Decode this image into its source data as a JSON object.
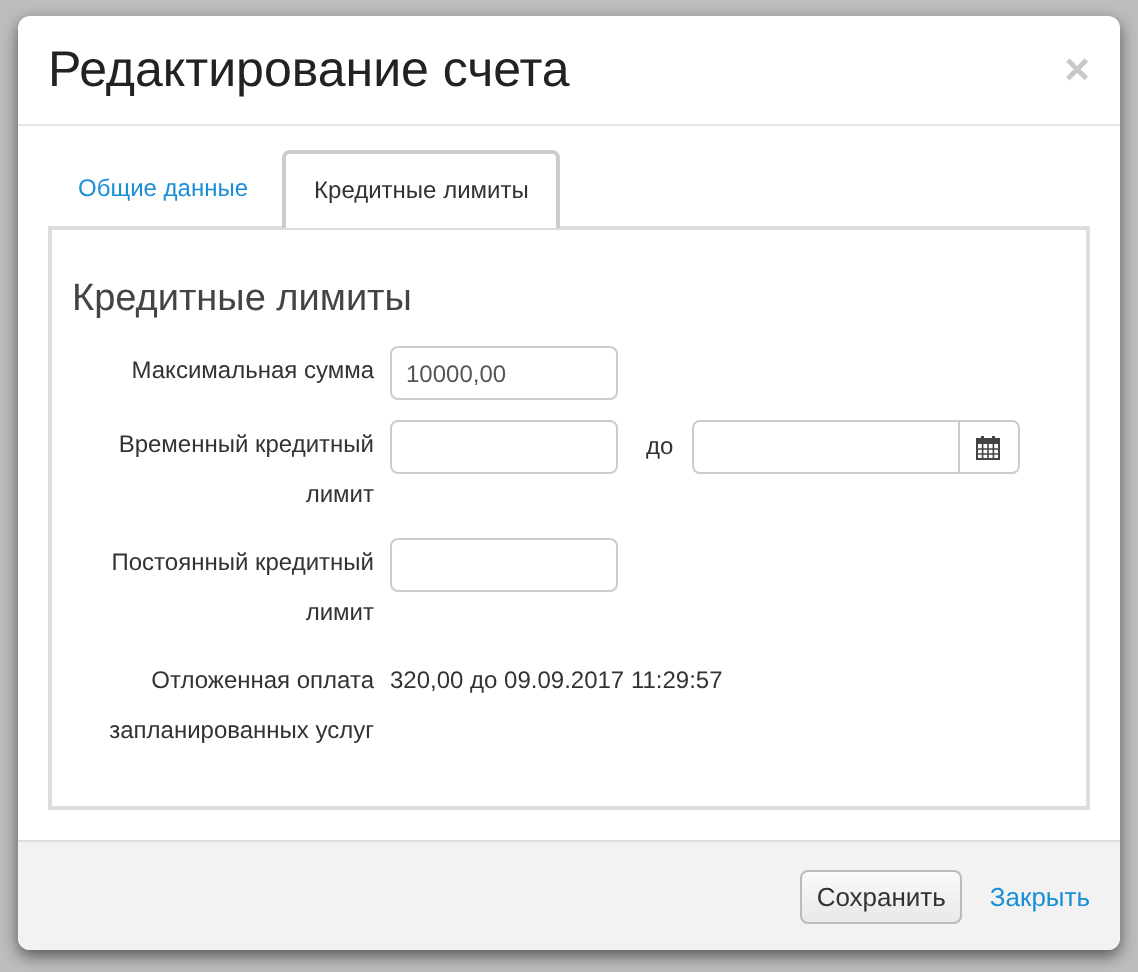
{
  "dialog": {
    "title": "Редактирование счета",
    "close": "×"
  },
  "tabs": [
    {
      "label": "Общие данные",
      "selected": false
    },
    {
      "label": "Кредитные лимиты",
      "selected": true
    }
  ],
  "section_title": "Кредитные лимиты",
  "rows": [
    {
      "kind": "input",
      "label": "Максимальная сумма",
      "value": "10000,00"
    },
    {
      "kind": "range",
      "label": "Временный кредитный лимит",
      "value": "",
      "separator": "до",
      "date_value": ""
    },
    {
      "kind": "input",
      "label": "Постоянный кредитный лимит",
      "value": ""
    },
    {
      "kind": "text",
      "label": "Отложенная оплата запланированных услуг",
      "value": "320,00 до 09.09.2017 11:29:57"
    }
  ],
  "buttons": [
    {
      "kind": "button",
      "label": "Сохранить"
    },
    {
      "kind": "link",
      "label": "Закрыть"
    }
  ]
}
